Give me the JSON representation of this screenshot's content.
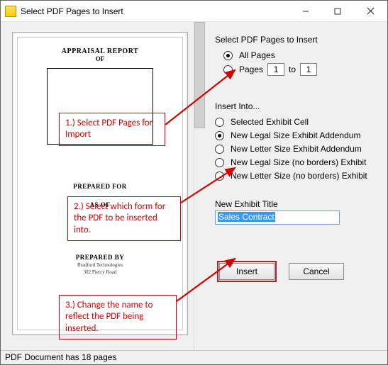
{
  "window": {
    "title": "Select PDF Pages to Insert"
  },
  "preview": {
    "title": "APPRAISAL REPORT",
    "of": "OF",
    "prepared_for": "PREPARED FOR",
    "as_of": "AS OF",
    "prepared_by": "PREPARED BY",
    "company": "Bradford Technologies",
    "addr": "302 Piercy Road"
  },
  "pages_group": {
    "title": "Select PDF Pages to Insert",
    "all_label": "All Pages",
    "range_label": "Pages",
    "from_value": "1",
    "to_label": "to",
    "to_value": "1",
    "selected": "all"
  },
  "insert_into": {
    "title": "Insert Into...",
    "options": [
      "Selected Exhibit Cell",
      "New Legal Size Exhibit Addendum",
      "New Letter Size Exhibit Addendum",
      "New Legal Size (no borders) Exhibit",
      "New Letter Size (no borders) Exhibit"
    ],
    "selected_index": 1
  },
  "exhibit_title": {
    "label": "New Exhibit Title",
    "value": "Sales Contract"
  },
  "buttons": {
    "insert": "Insert",
    "cancel": "Cancel"
  },
  "status": "PDF Document has 18 pages",
  "annotations": {
    "a1": "1.) Select PDF Pages for Import",
    "a2": "2.) Select which form for the PDF to be inserted into.",
    "a3": "3.) Change the name to reflect the PDF being inserted."
  }
}
